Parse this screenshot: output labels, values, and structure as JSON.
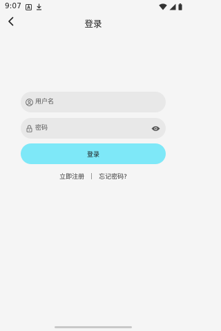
{
  "status_bar": {
    "time": "9:07",
    "icons": [
      "notification-a-icon",
      "download-icon",
      "wifi-icon",
      "cell-signal-icon",
      "battery-icon"
    ]
  },
  "app_bar": {
    "title": "登录",
    "back_icon": "chevron-left-icon"
  },
  "form": {
    "username": {
      "placeholder": "用户名",
      "value": "",
      "icon": "user-icon"
    },
    "password": {
      "placeholder": "密码",
      "value": "",
      "icon": "lock-icon",
      "toggle_icon": "eye-icon"
    },
    "login_button": "登录"
  },
  "links": {
    "register": "立即注册",
    "separator": "|",
    "forgot": "忘记密码?"
  },
  "colors": {
    "background": "#f5f5f5",
    "field_bg": "#e8e8e8",
    "accent": "#7ee8f8"
  }
}
